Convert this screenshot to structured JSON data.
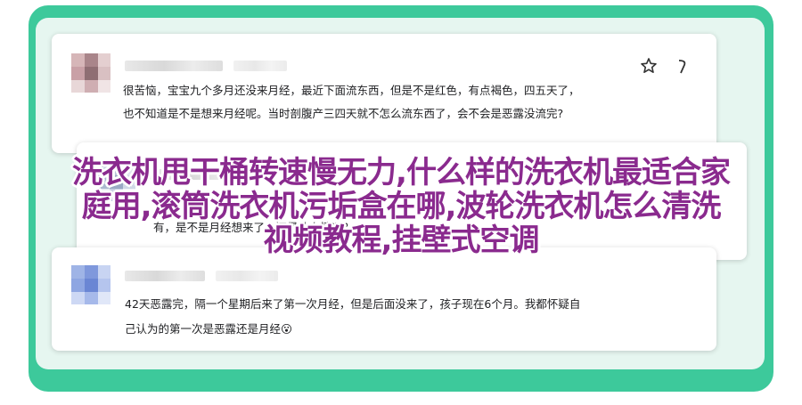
{
  "comments": [
    {
      "line1": "很苦恼，宝宝九个多月还没来月经，最近下面流东西，但是不是红色，有点褐色，四五天了，",
      "line2": "也不知道是不是想来月经呢。当时剖腹产三四天就不怎么流东西了，会不会是恶露没流完?"
    },
    {
      "line1": "有，是不是月经想来了，还是什么情况？",
      "line2": ""
    },
    {
      "line1": "42天恶露完，隔一个星期后来了第一次月经，但是后面没来了，孩子现在6个月。我都怀疑自",
      "line2": "己认为的第一次是恶露还是月经😮"
    }
  ],
  "overlay_title": {
    "line1": "洗衣机甩干桶转速慢无力,什么样的洗衣机最适合家",
    "line2": "庭用,滚筒洗衣机污垢盒在哪,波轮洗衣机怎么清洗",
    "line3": "视频教程,挂壁式空调"
  },
  "icons": {
    "star": "star-outline-icon",
    "more": "more-icon"
  },
  "colors": {
    "frame": "#3dc99b",
    "overlay_text": "#8a2a8e"
  }
}
